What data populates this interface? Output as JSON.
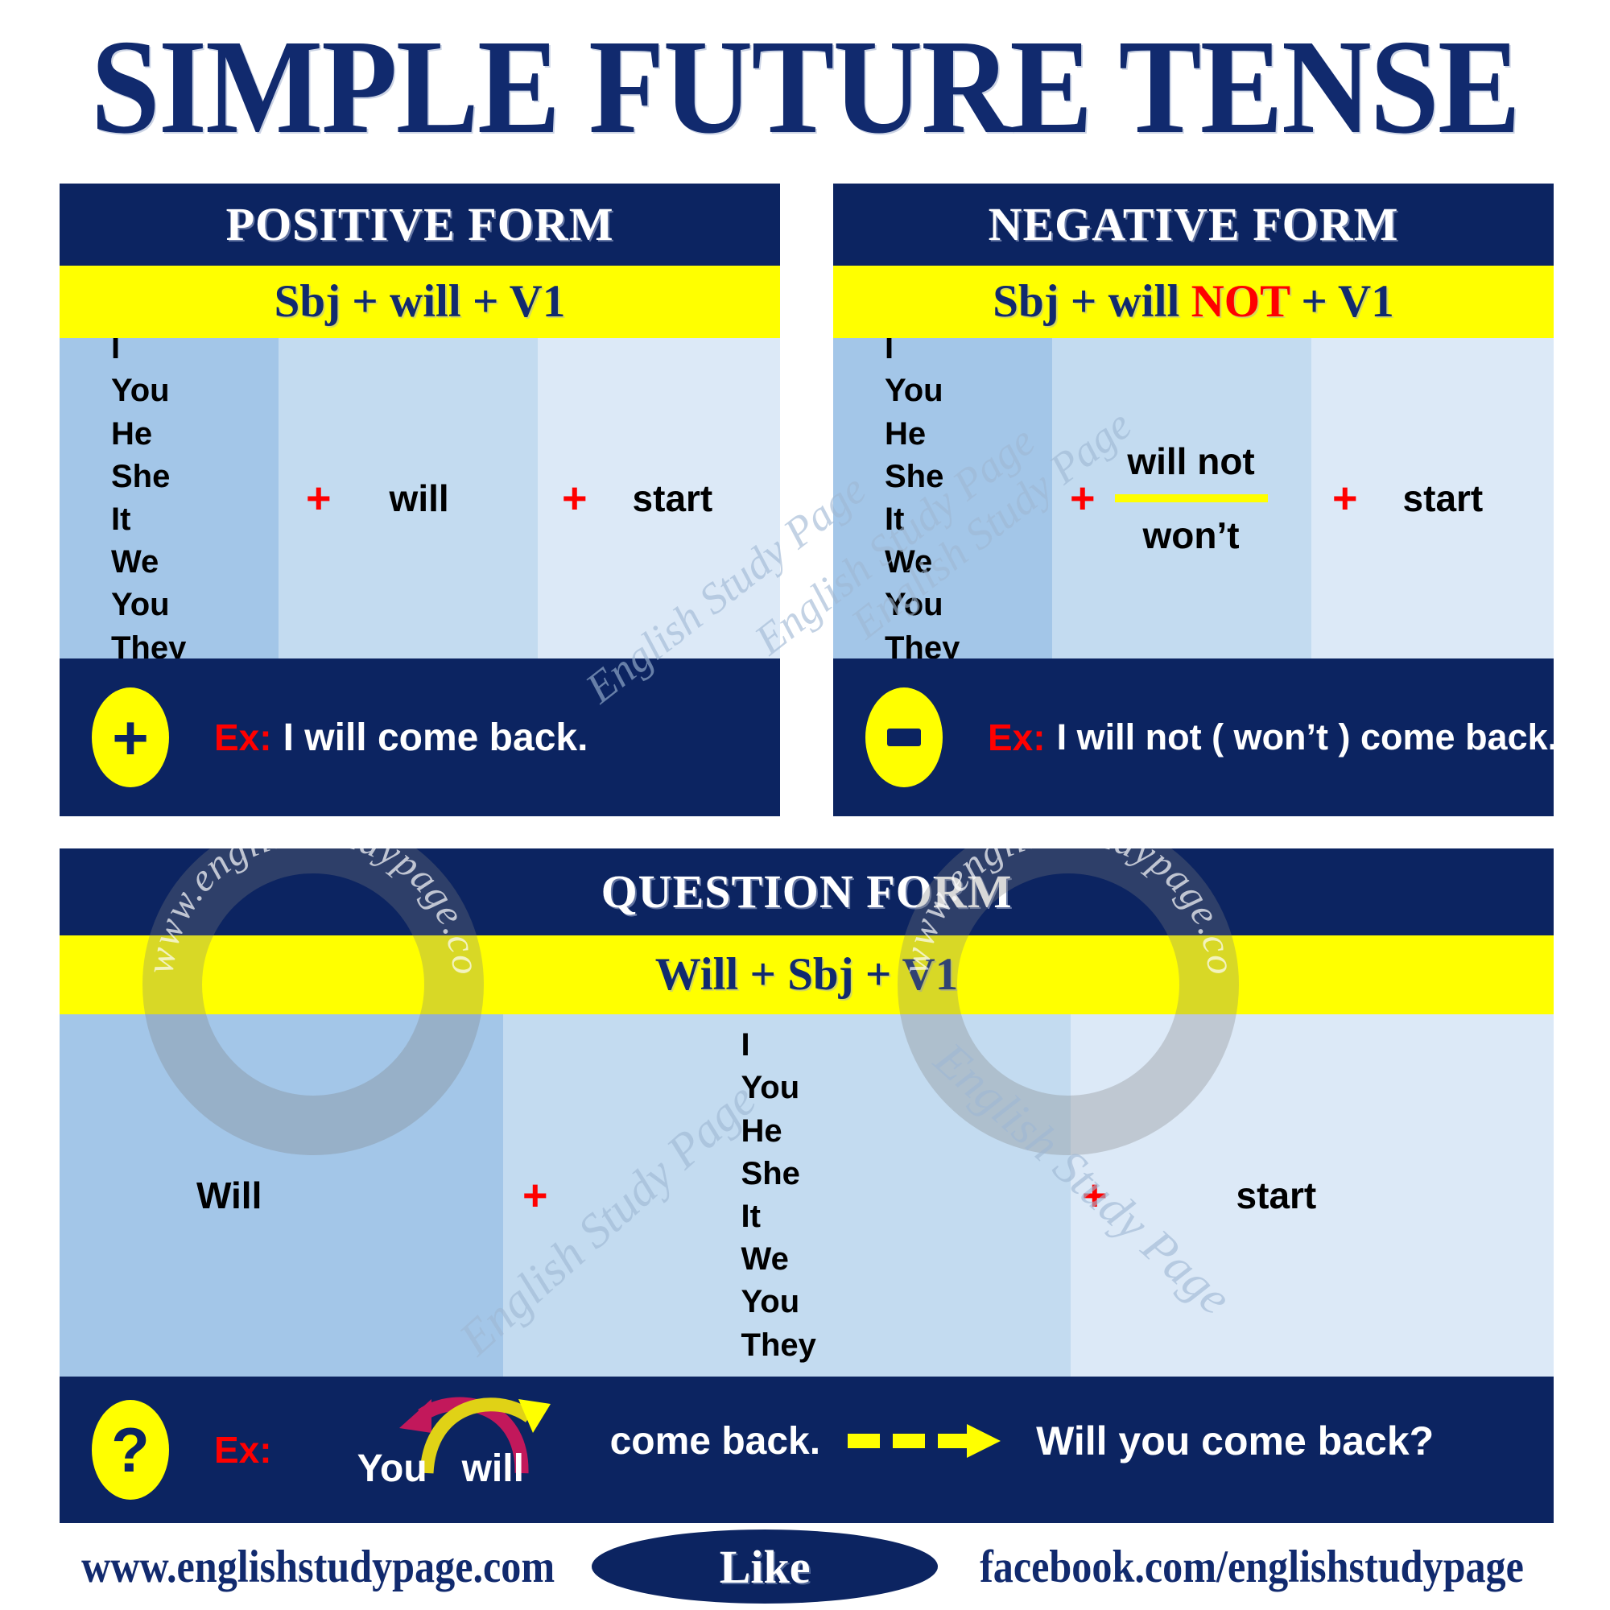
{
  "title": "SIMPLE FUTURE TENSE",
  "colors": {
    "navy": "#0c2461",
    "title_navy": "#112a6e",
    "yellow": "#ffff00",
    "red": "#ff0000",
    "col_dark": "#a3c6e8",
    "col_mid": "#c3dbf0",
    "col_light": "#dce9f7",
    "magenta": "#c2185b"
  },
  "pronouns": "I\nYou\nHe\nShe\nIt\nWe\nYou\nThey",
  "positive": {
    "header": "POSITIVE FORM",
    "formula_a": "Sbj + will + V1",
    "col2_plus": "+",
    "col2_word": "will",
    "col3_plus": "+",
    "col3_word": "start",
    "badge": "+",
    "ex_label": "Ex:",
    "example": "I will come back."
  },
  "negative": {
    "header": "NEGATIVE FORM",
    "formula_a": "Sbj + will ",
    "formula_not": "NOT",
    "formula_b": " + V1",
    "col2_plus": "+",
    "col2_word_top": "will not",
    "col2_word_bottom": "won’t",
    "col3_plus": "+",
    "col3_word": "start",
    "badge": "–",
    "ex_label": "Ex:",
    "example": "I will not ( won’t ) come back."
  },
  "question": {
    "header": "QUESTION FORM",
    "formula": "Will +  Sbj + V1",
    "col1_word": "Will",
    "col2_plus": "+",
    "col3_plus": "+",
    "col4_word": "start",
    "badge": "?",
    "ex_label": "Ex:",
    "swap_word1": "You",
    "swap_word2": "will",
    "sentence_tail": "come back.",
    "result": "Will you come back?"
  },
  "watermarks": {
    "diagonal": "English Study Page",
    "ring": "www.englishstudypage.com"
  },
  "footer": {
    "site": "www.englishstudypage.com",
    "like": "Like",
    "facebook": "facebook.com/englishstudypage"
  }
}
